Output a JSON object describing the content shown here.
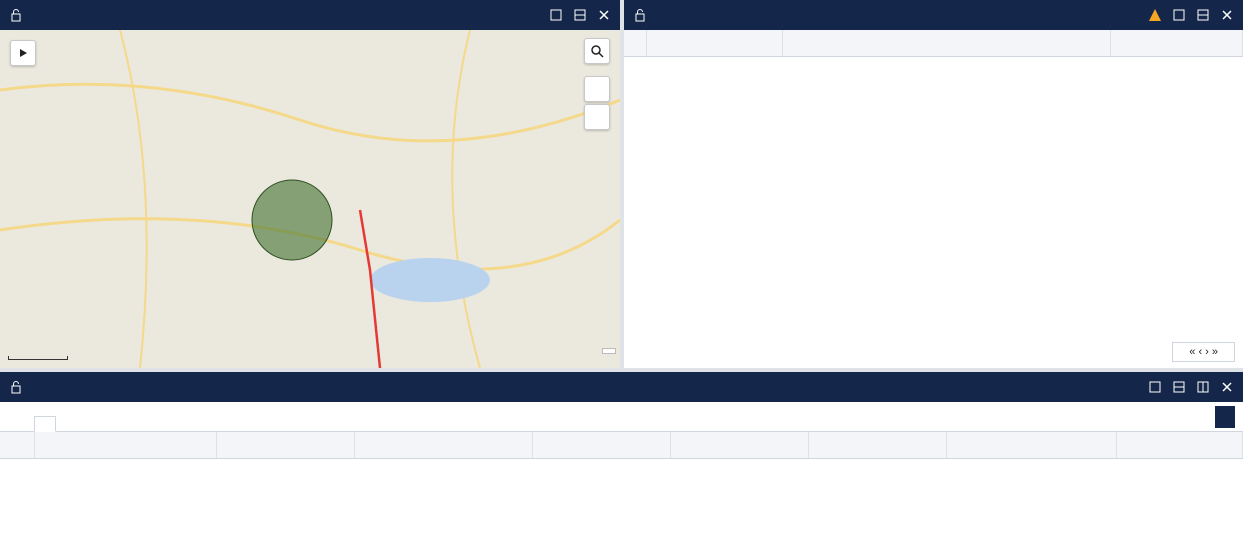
{
  "map_panel": {
    "title": "",
    "provider_link": "",
    "search_icon": "search-icon",
    "play_icon": "play-icon",
    "zoom_in": "",
    "zoom_out": "",
    "scale_label": "",
    "coords_readout": "",
    "copyright": ""
  },
  "events_panel": {
    "title": "",
    "warning_icon": "warning-icon",
    "columns": [
      "",
      "",
      ""
    ],
    "rows": [],
    "pager": {
      "page_label": "",
      "page_size": ""
    }
  },
  "media_panel": {
    "title": "",
    "tabs": [
      "",
      ""
    ],
    "order_button": "",
    "columns": [
      "",
      "",
      "",
      "",
      "",
      "",
      "",
      ""
    ],
    "rows": []
  },
  "colors": {
    "header": "#14274a",
    "selected_row": "#14274a",
    "route": "#e53935"
  }
}
